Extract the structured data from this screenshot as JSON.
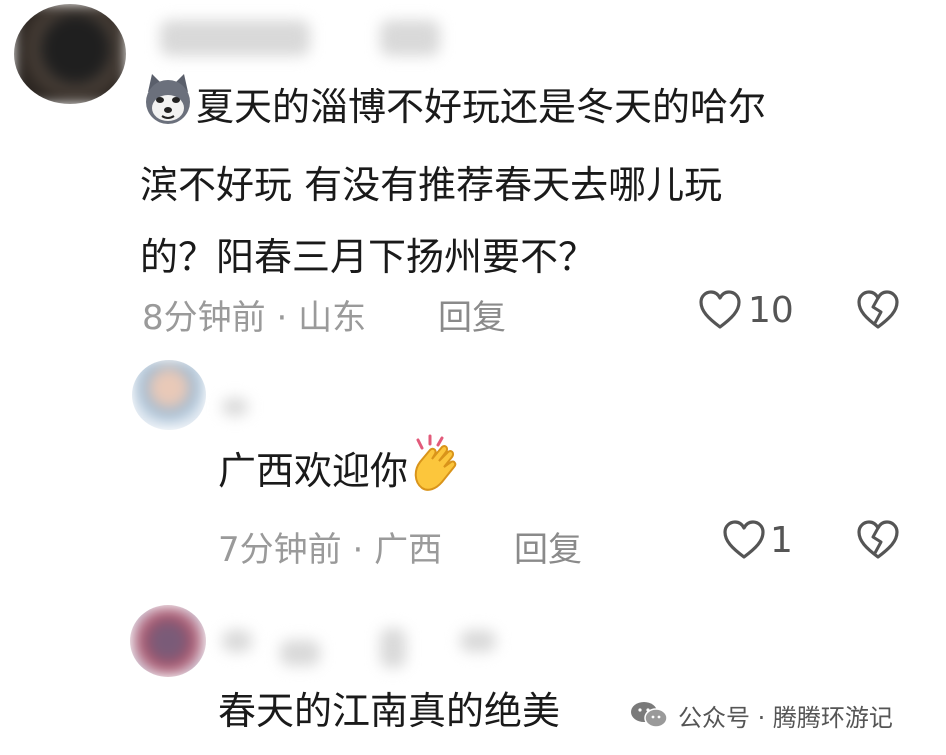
{
  "comments": [
    {
      "text_lines": [
        "夏天的淄博不好玩还是冬天的哈尔",
        "滨不好玩 有没有推荐春天去哪儿玩",
        "的？阳春三月下扬州要不？"
      ],
      "time": "8分钟前",
      "location": "山东",
      "reply_label": "回复",
      "likes": "10"
    },
    {
      "text": "广西欢迎你",
      "time": "7分钟前",
      "location": "广西",
      "reply_label": "回复",
      "likes": "1"
    },
    {
      "text": "春天的江南真的绝美"
    }
  ],
  "meta_separator": "·",
  "watermark": {
    "text": "公众号 · 腾腾环游记"
  },
  "icons": {
    "like": "heart-outline-icon",
    "dislike": "broken-heart-icon",
    "emoji_dog": "husky-dog-emoji",
    "emoji_clap": "clapping-hands-emoji",
    "wechat": "wechat-icon"
  },
  "colors": {
    "text": "#1a1a1a",
    "meta": "#9a9a9a",
    "background": "#ffffff"
  }
}
